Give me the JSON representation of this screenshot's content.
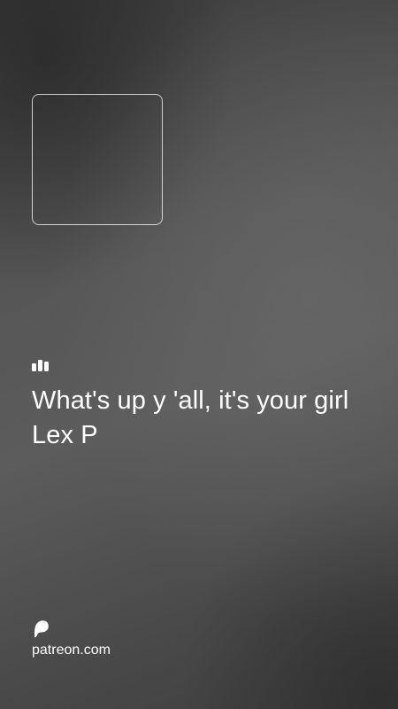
{
  "post": {
    "quote_text": "What's up y 'all, it's your girl Lex P"
  },
  "icons": {
    "audio": "audio-bars-icon",
    "brand": "patreon-logo-icon"
  },
  "footer": {
    "link_text": "patreon.com"
  },
  "colors": {
    "text": "#ffffff",
    "background_dark": "#3a3a3a",
    "background_light": "#5c5c5c"
  }
}
